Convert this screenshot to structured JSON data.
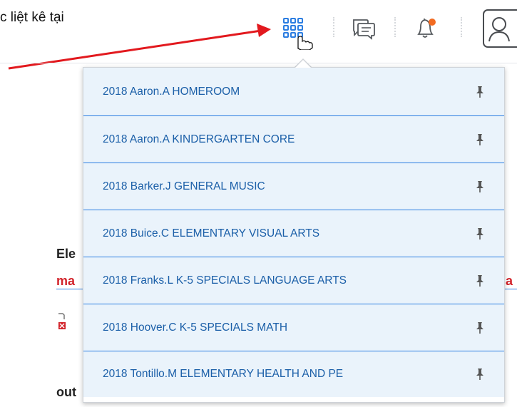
{
  "caption": "c liệt kê tại",
  "background_fragments": {
    "heading": "Ele",
    "red_left": "ma",
    "red_right": "a",
    "bottom": "out"
  },
  "topbar": {
    "icons": [
      "apps-grid-icon",
      "message-icon",
      "notification-bell-icon",
      "user-profile-icon"
    ],
    "notification_dot_color": "#f26b21"
  },
  "course_selector": {
    "courses": [
      {
        "name": "2018 Aaron.A HOMEROOM"
      },
      {
        "name": "2018 Aaron.A KINDERGARTEN CORE"
      },
      {
        "name": "2018 Barker.J GENERAL MUSIC"
      },
      {
        "name": "2018 Buice.C ELEMENTARY VISUAL ARTS"
      },
      {
        "name": "2018 Franks.L K-5 SPECIALS LANGUAGE ARTS"
      },
      {
        "name": "2018 Hoover.C K-5 SPECIALS MATH"
      },
      {
        "name": "2018 Tontillo.M ELEMENTARY HEALTH AND PE"
      }
    ]
  },
  "colors": {
    "accent_blue": "#2b7de1",
    "item_bg": "#eaf3fb",
    "item_text": "#1b5fa8",
    "annotation_red": "#e2191e"
  }
}
